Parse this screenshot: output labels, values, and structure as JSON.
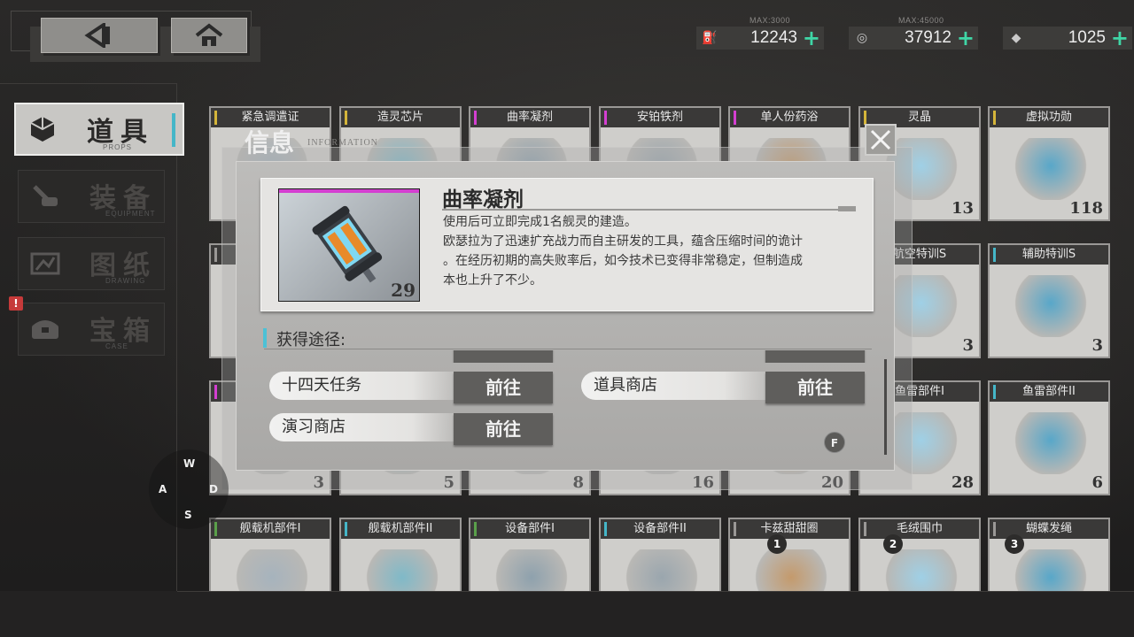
{
  "resources": [
    {
      "name": "oil",
      "icon": "oil-icon",
      "max": "MAX:3000",
      "value": "12243"
    },
    {
      "name": "coin",
      "icon": "coin-icon",
      "max": "MAX:45000",
      "value": "37912"
    },
    {
      "name": "gem",
      "icon": "gem-icon",
      "max": "",
      "value": "1025"
    }
  ],
  "side_menu": [
    {
      "label": "道具",
      "sub": "PROPS",
      "active": true,
      "icon": "cube-icon"
    },
    {
      "label": "装备",
      "sub": "EQUIPMENT",
      "active": false,
      "icon": "cannon-icon"
    },
    {
      "label": "图纸",
      "sub": "DRAWING",
      "active": false,
      "icon": "blueprint-icon"
    },
    {
      "label": "宝箱",
      "sub": "CASE",
      "active": false,
      "icon": "chest-icon"
    }
  ],
  "alert_badge": "!",
  "grid_items": [
    {
      "title": "紧急调遣证",
      "count": "",
      "rarity": "#d4b53a"
    },
    {
      "title": "造灵芯片",
      "count": "",
      "rarity": "#d4b53a"
    },
    {
      "title": "曲率凝剂",
      "count": "",
      "rarity": "#d43fd1"
    },
    {
      "title": "安铂铁剂",
      "count": "",
      "rarity": "#d43fd1"
    },
    {
      "title": "单人份药浴",
      "count": "",
      "rarity": "#d43fd1"
    },
    {
      "title": "灵晶",
      "count": "13",
      "rarity": "#d4b53a"
    },
    {
      "title": "虚拟功勋",
      "count": "118",
      "rarity": "#d4b53a"
    },
    {
      "title": "",
      "count": "",
      "rarity": "#9a9896"
    },
    {
      "title": "",
      "count": "",
      "rarity": "#9a9896"
    },
    {
      "title": "",
      "count": "",
      "rarity": "#9a9896"
    },
    {
      "title": "",
      "count": "",
      "rarity": "#9a9896"
    },
    {
      "title": "",
      "count": "",
      "rarity": "#9a9896"
    },
    {
      "title": "航空特训S",
      "count": "3",
      "rarity": "#45b6c8"
    },
    {
      "title": "辅助特训S",
      "count": "3",
      "rarity": "#45b6c8"
    },
    {
      "title": "",
      "count": "3",
      "rarity": "#d43fd1"
    },
    {
      "title": "",
      "count": "5",
      "rarity": "#45b6c8"
    },
    {
      "title": "",
      "count": "8",
      "rarity": "#45b6c8"
    },
    {
      "title": "",
      "count": "16",
      "rarity": "#45b6c8"
    },
    {
      "title": "",
      "count": "20",
      "rarity": "#45b6c8"
    },
    {
      "title": "鱼雷部件I",
      "count": "28",
      "rarity": "#5aa04a"
    },
    {
      "title": "鱼雷部件II",
      "count": "6",
      "rarity": "#45b6c8"
    },
    {
      "title": "舰载机部件I",
      "count": "",
      "rarity": "#5aa04a"
    },
    {
      "title": "舰载机部件II",
      "count": "",
      "rarity": "#45b6c8"
    },
    {
      "title": "设备部件I",
      "count": "",
      "rarity": "#5aa04a"
    },
    {
      "title": "设备部件II",
      "count": "",
      "rarity": "#45b6c8"
    },
    {
      "title": "卡兹甜甜圈",
      "count": "",
      "rarity": "#9a9896"
    },
    {
      "title": "毛绒围巾",
      "count": "",
      "rarity": "#9a9896"
    },
    {
      "title": "蝴蝶发绳",
      "count": "",
      "rarity": "#9a9896"
    }
  ],
  "dialog": {
    "header": "信息",
    "header_sub": "INFORMATION",
    "item_name": "曲率凝剂",
    "item_qty": "29",
    "desc_lines": [
      "使用后可立即完成1名舰灵的建造。",
      "欧瑟拉为了迅速扩充战力而自主研发的工具，蕴含压缩时间的诡计",
      "。在经历初期的高失败率后，如今技术已变得非常稳定，但制造成",
      "本也上升了不少。"
    ],
    "sources_title": "获得途径:",
    "sources": [
      {
        "label": "十四天任务",
        "go": "前往"
      },
      {
        "label": "道具商店",
        "go": "前往"
      },
      {
        "label": "演习商店",
        "go": "前往"
      }
    ],
    "go_label": "前往",
    "f_hint": "F"
  },
  "wasd": {
    "w": "W",
    "a": "A",
    "s": "S",
    "d": "D"
  },
  "number_hints": [
    "1",
    "2",
    "3"
  ]
}
